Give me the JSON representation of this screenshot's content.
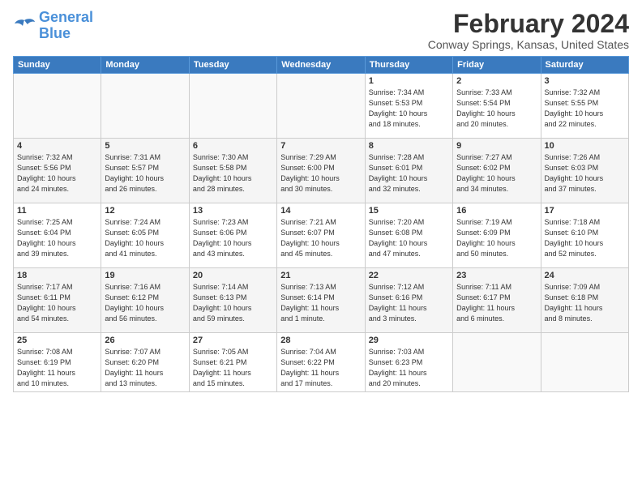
{
  "logo": {
    "line1": "General",
    "line2": "Blue"
  },
  "title": "February 2024",
  "subtitle": "Conway Springs, Kansas, United States",
  "days_of_week": [
    "Sunday",
    "Monday",
    "Tuesday",
    "Wednesday",
    "Thursday",
    "Friday",
    "Saturday"
  ],
  "weeks": [
    [
      {
        "day": "",
        "info": ""
      },
      {
        "day": "",
        "info": ""
      },
      {
        "day": "",
        "info": ""
      },
      {
        "day": "",
        "info": ""
      },
      {
        "day": "1",
        "info": "Sunrise: 7:34 AM\nSunset: 5:53 PM\nDaylight: 10 hours\nand 18 minutes."
      },
      {
        "day": "2",
        "info": "Sunrise: 7:33 AM\nSunset: 5:54 PM\nDaylight: 10 hours\nand 20 minutes."
      },
      {
        "day": "3",
        "info": "Sunrise: 7:32 AM\nSunset: 5:55 PM\nDaylight: 10 hours\nand 22 minutes."
      }
    ],
    [
      {
        "day": "4",
        "info": "Sunrise: 7:32 AM\nSunset: 5:56 PM\nDaylight: 10 hours\nand 24 minutes."
      },
      {
        "day": "5",
        "info": "Sunrise: 7:31 AM\nSunset: 5:57 PM\nDaylight: 10 hours\nand 26 minutes."
      },
      {
        "day": "6",
        "info": "Sunrise: 7:30 AM\nSunset: 5:58 PM\nDaylight: 10 hours\nand 28 minutes."
      },
      {
        "day": "7",
        "info": "Sunrise: 7:29 AM\nSunset: 6:00 PM\nDaylight: 10 hours\nand 30 minutes."
      },
      {
        "day": "8",
        "info": "Sunrise: 7:28 AM\nSunset: 6:01 PM\nDaylight: 10 hours\nand 32 minutes."
      },
      {
        "day": "9",
        "info": "Sunrise: 7:27 AM\nSunset: 6:02 PM\nDaylight: 10 hours\nand 34 minutes."
      },
      {
        "day": "10",
        "info": "Sunrise: 7:26 AM\nSunset: 6:03 PM\nDaylight: 10 hours\nand 37 minutes."
      }
    ],
    [
      {
        "day": "11",
        "info": "Sunrise: 7:25 AM\nSunset: 6:04 PM\nDaylight: 10 hours\nand 39 minutes."
      },
      {
        "day": "12",
        "info": "Sunrise: 7:24 AM\nSunset: 6:05 PM\nDaylight: 10 hours\nand 41 minutes."
      },
      {
        "day": "13",
        "info": "Sunrise: 7:23 AM\nSunset: 6:06 PM\nDaylight: 10 hours\nand 43 minutes."
      },
      {
        "day": "14",
        "info": "Sunrise: 7:21 AM\nSunset: 6:07 PM\nDaylight: 10 hours\nand 45 minutes."
      },
      {
        "day": "15",
        "info": "Sunrise: 7:20 AM\nSunset: 6:08 PM\nDaylight: 10 hours\nand 47 minutes."
      },
      {
        "day": "16",
        "info": "Sunrise: 7:19 AM\nSunset: 6:09 PM\nDaylight: 10 hours\nand 50 minutes."
      },
      {
        "day": "17",
        "info": "Sunrise: 7:18 AM\nSunset: 6:10 PM\nDaylight: 10 hours\nand 52 minutes."
      }
    ],
    [
      {
        "day": "18",
        "info": "Sunrise: 7:17 AM\nSunset: 6:11 PM\nDaylight: 10 hours\nand 54 minutes."
      },
      {
        "day": "19",
        "info": "Sunrise: 7:16 AM\nSunset: 6:12 PM\nDaylight: 10 hours\nand 56 minutes."
      },
      {
        "day": "20",
        "info": "Sunrise: 7:14 AM\nSunset: 6:13 PM\nDaylight: 10 hours\nand 59 minutes."
      },
      {
        "day": "21",
        "info": "Sunrise: 7:13 AM\nSunset: 6:14 PM\nDaylight: 11 hours\nand 1 minute."
      },
      {
        "day": "22",
        "info": "Sunrise: 7:12 AM\nSunset: 6:16 PM\nDaylight: 11 hours\nand 3 minutes."
      },
      {
        "day": "23",
        "info": "Sunrise: 7:11 AM\nSunset: 6:17 PM\nDaylight: 11 hours\nand 6 minutes."
      },
      {
        "day": "24",
        "info": "Sunrise: 7:09 AM\nSunset: 6:18 PM\nDaylight: 11 hours\nand 8 minutes."
      }
    ],
    [
      {
        "day": "25",
        "info": "Sunrise: 7:08 AM\nSunset: 6:19 PM\nDaylight: 11 hours\nand 10 minutes."
      },
      {
        "day": "26",
        "info": "Sunrise: 7:07 AM\nSunset: 6:20 PM\nDaylight: 11 hours\nand 13 minutes."
      },
      {
        "day": "27",
        "info": "Sunrise: 7:05 AM\nSunset: 6:21 PM\nDaylight: 11 hours\nand 15 minutes."
      },
      {
        "day": "28",
        "info": "Sunrise: 7:04 AM\nSunset: 6:22 PM\nDaylight: 11 hours\nand 17 minutes."
      },
      {
        "day": "29",
        "info": "Sunrise: 7:03 AM\nSunset: 6:23 PM\nDaylight: 11 hours\nand 20 minutes."
      },
      {
        "day": "",
        "info": ""
      },
      {
        "day": "",
        "info": ""
      }
    ]
  ]
}
